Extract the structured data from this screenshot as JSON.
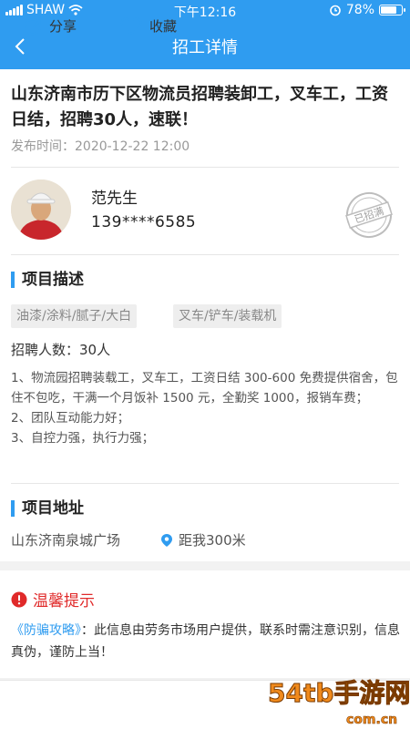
{
  "status_bar": {
    "carrier": "SHAW",
    "time": "下午12:16",
    "battery": "78%",
    "battery_level": 0.78
  },
  "nav": {
    "title": "招工详情",
    "back_icon": "chevron-left-icon"
  },
  "job": {
    "title": "山东济南市历下区物流员招聘装卸工，叉车工，工资日结，招聘30人，速联！",
    "publish_label": "发布时间：",
    "publish_time": "2020-12-22 12:00"
  },
  "contact": {
    "name": "范先生",
    "phone": "139****6585",
    "stamp": "已招满"
  },
  "project": {
    "heading": "项目描述",
    "tags": [
      "油漆/涂料/腻子/大白",
      "叉车/铲车/装载机"
    ],
    "recruit_count": "招聘人数：30人",
    "description": [
      "1、物流园招聘装载工，叉车工，工资日结 300-600 免费提供宿舍，包住不包吃，干满一个月饭补 1500 元，全勤奖 1000，报销车费；",
      "2、团队互动能力好；",
      "3、自控力强，执行力强；"
    ]
  },
  "location": {
    "heading": "项目地址",
    "address": "山东济南泉城广场",
    "distance": "距我300米"
  },
  "tip": {
    "heading": "温馨提示",
    "link": "《防骗攻略》",
    "text": "：此信息由劳务市场用户提供，联系时需注意识别，信息真伪，谨防上当！"
  },
  "actions": {
    "share": "分享",
    "favorite": "收藏"
  },
  "watermark": {
    "brand": "54tb手游网",
    "site": "com.cn"
  },
  "colors": {
    "primary": "#2f9cf0",
    "warning": "#e02a2a"
  }
}
